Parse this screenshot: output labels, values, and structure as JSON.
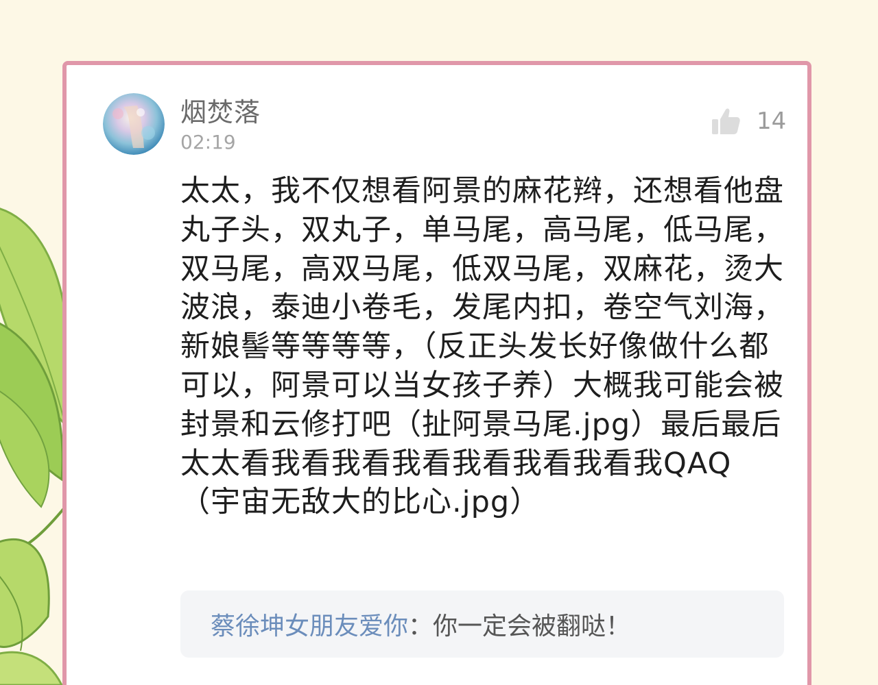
{
  "comment": {
    "author": "烟焚落",
    "time": "02:19",
    "likes": "14",
    "text": "太太，我不仅想看阿景的麻花辫，还想看他盘丸子头，双丸子，单马尾，高马尾，低马尾，双马尾，高双马尾，低双马尾，双麻花，烫大波浪，泰迪小卷毛，发尾内扣，卷空气刘海，新娘髻等等等等，（反正头发长好像做什么都可以，阿景可以当女孩子养）大概我可能会被封景和云修打吧（扯阿景马尾.jpg）最后最后太太看我看我看我看我看我看我看我QAQ（宇宙无敌大的比心.jpg）"
  },
  "reply": {
    "author": "蔡徐坤女朋友爱你",
    "separator": "：",
    "text": "你一定会被翻哒！"
  },
  "icons": {
    "like": "thumbs-up-icon",
    "avatar": "avatar-image"
  },
  "colors": {
    "background": "#fdf8e6",
    "card_border": "#e097a9",
    "reply_author": "#6b8dbb",
    "reply_box": "#f4f5f7"
  }
}
